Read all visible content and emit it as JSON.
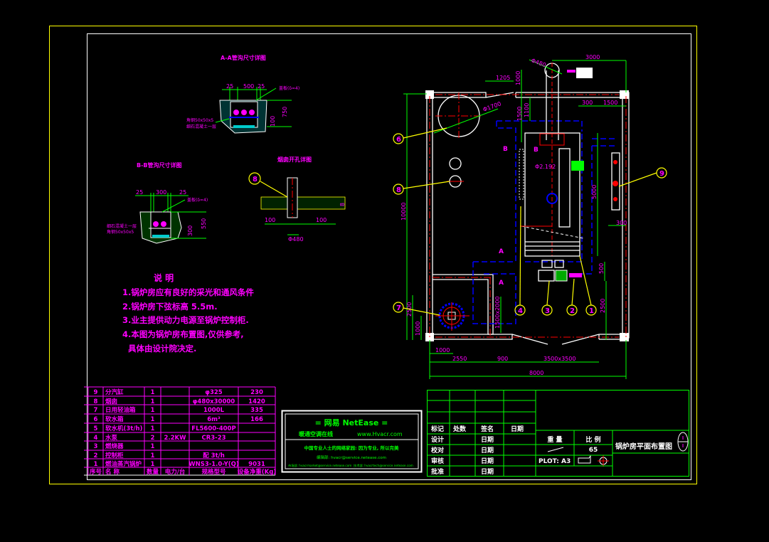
{
  "colors": {
    "background": "#000000",
    "frame": "#ffff00",
    "text_magenta": "#ff00ff",
    "lines_green": "#00ff00",
    "walls": "#ffffff",
    "centerline": "#ff0000",
    "trench": "#0000ff",
    "leader": "#ffff00"
  },
  "details": {
    "aa_title": "A-A管沟尺寸详图",
    "aa_dims": [
      "25",
      "500",
      "25",
      "750",
      "100"
    ],
    "aa_note1": "角钢50x50x5",
    "aa_note2": "细石混凝土一层",
    "aa_cover": "盖板(δ=4)",
    "bb_title": "B-B管沟尺寸详图",
    "bb_dims": [
      "25",
      "300",
      "25",
      "550",
      "300"
    ],
    "bb_note1": "细石混凝土一层",
    "bb_note2": "角钢50x50x5",
    "bb_cover": "盖板(δ=4)",
    "chimney_title": "烟囱开孔详图",
    "chimney_dims": [
      "100",
      "100",
      "Φ480",
      "8"
    ],
    "chimney_bubble": "8"
  },
  "notes": {
    "title": "说  明",
    "items": [
      "1.锅炉房应有良好的采光和通风条件",
      "2.锅炉房下弦标高 5.5m.",
      "3.业主提供动力电源至锅炉控制柜.",
      "4.本图为锅炉房布置图,仅供参考,",
      "  具体由设计院决定."
    ]
  },
  "plan": {
    "dims": {
      "top_1205": "1205",
      "top_1000": "1000",
      "top_3000": "3000",
      "chimney_dia": "Φ480",
      "tank_dia": "Φ1700",
      "d1100": "1100",
      "d1500v": "1500",
      "d300": "300",
      "d1500": "1500",
      "d10000": "10000",
      "d5000": "5000",
      "d300b": "300",
      "d500": "500",
      "d2500r": "2500",
      "d2500l": "2500",
      "d1000": "1000",
      "d1000b": "1000",
      "d2550": "2550",
      "d900": "900",
      "door": "3500x3500",
      "d8000": "8000",
      "opening": "1500x2000",
      "boiler_dia": "Φ2.192"
    },
    "section_marks": [
      "B",
      "B",
      "A",
      "A"
    ],
    "bubbles": [
      "6",
      "8",
      "9",
      "7",
      "4",
      "3",
      "2",
      "1"
    ]
  },
  "equipment_table": {
    "headers": [
      "序号",
      "名  称",
      "数量",
      "电力/台",
      "规格型号",
      "设备净重(Kg)"
    ],
    "rows": [
      [
        "9",
        "分汽缸",
        "1",
        "",
        "φ325",
        "230"
      ],
      [
        "8",
        "烟囱",
        "1",
        "",
        "φ480x30000",
        "1420"
      ],
      [
        "7",
        "日用轻油箱",
        "1",
        "",
        "1000L",
        "335"
      ],
      [
        "6",
        "软水箱",
        "1",
        "",
        "6m³",
        "166"
      ],
      [
        "5",
        "软水机(3t/h)",
        "1",
        "",
        "FL5600-400P",
        ""
      ],
      [
        "4",
        "水泵",
        "2",
        "2.2KW",
        "CR3-23",
        ""
      ],
      [
        "3",
        "燃烧器",
        "1",
        "",
        "",
        ""
      ],
      [
        "2",
        "控制柜",
        "1",
        "",
        "配 3t/h",
        ""
      ],
      [
        "1",
        "燃油蒸汽锅炉",
        "1",
        "",
        "WNS3-1.0-Y(Q)",
        "9031"
      ]
    ]
  },
  "netease": {
    "title": "=  网易 NetEase  =",
    "line1": "暖通空调在线",
    "url": "www.Hvacr.com",
    "slogan": "中国专业人士的网络家园: 因为专业, 所以完美",
    "email1": "编辑部: hvacr@service.netease.com",
    "email2": "市场部: hvacrmarket@service.netease.com",
    "email3": "技术部: hvacrtech@service.netease.com"
  },
  "title_block": {
    "rev_headers": [
      "标记",
      "处数",
      "签名",
      "日期"
    ],
    "roles": [
      "设计",
      "校对",
      "审核",
      "批准"
    ],
    "date_label": "日期",
    "weight_label": "重 量",
    "scale_label": "比 例",
    "scale_value": "65",
    "plot": "PLOT: A3",
    "drawing_title": "锅炉房平面布置图"
  }
}
